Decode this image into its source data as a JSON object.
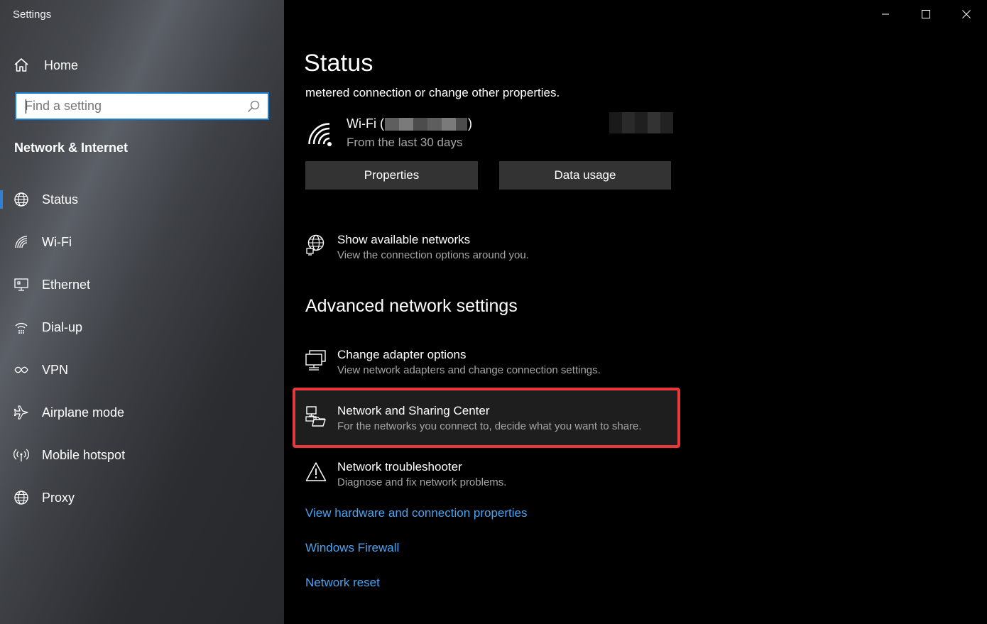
{
  "window": {
    "title": "Settings",
    "controls": [
      "minimize-icon",
      "maximize-icon",
      "close-icon"
    ]
  },
  "sidebar": {
    "home_label": "Home",
    "search_placeholder": "Find a setting",
    "section_title": "Network & Internet",
    "items": [
      {
        "label": "Status",
        "icon": "globe-icon",
        "active": true
      },
      {
        "label": "Wi-Fi",
        "icon": "wifi-icon",
        "active": false
      },
      {
        "label": "Ethernet",
        "icon": "ethernet-icon",
        "active": false
      },
      {
        "label": "Dial-up",
        "icon": "dialup-icon",
        "active": false
      },
      {
        "label": "VPN",
        "icon": "vpn-icon",
        "active": false
      },
      {
        "label": "Airplane mode",
        "icon": "airplane-icon",
        "active": false
      },
      {
        "label": "Mobile hotspot",
        "icon": "hotspot-icon",
        "active": false
      },
      {
        "label": "Proxy",
        "icon": "globe-icon",
        "active": false
      }
    ]
  },
  "main": {
    "title": "Status",
    "intro": "metered connection or change other properties.",
    "connection": {
      "name_prefix": "Wi-Fi (",
      "name_suffix": ")",
      "period": "From the last 30 days"
    },
    "buttons": {
      "properties": "Properties",
      "data_usage": "Data usage"
    },
    "show_networks": {
      "title": "Show available networks",
      "desc": "View the connection options around you."
    },
    "advanced_heading": "Advanced network settings",
    "advanced_items": [
      {
        "title": "Change adapter options",
        "desc": "View network adapters and change connection settings."
      },
      {
        "title": "Network and Sharing Center",
        "desc": "For the networks you connect to, decide what you want to share."
      },
      {
        "title": "Network troubleshooter",
        "desc": "Diagnose and fix network problems."
      }
    ],
    "links": [
      "View hardware and connection properties",
      "Windows Firewall",
      "Network reset"
    ]
  },
  "colors": {
    "accent": "#2f7fd9",
    "link": "#4aa3ef",
    "highlight": "#e8383b",
    "button_bg": "#333333"
  }
}
